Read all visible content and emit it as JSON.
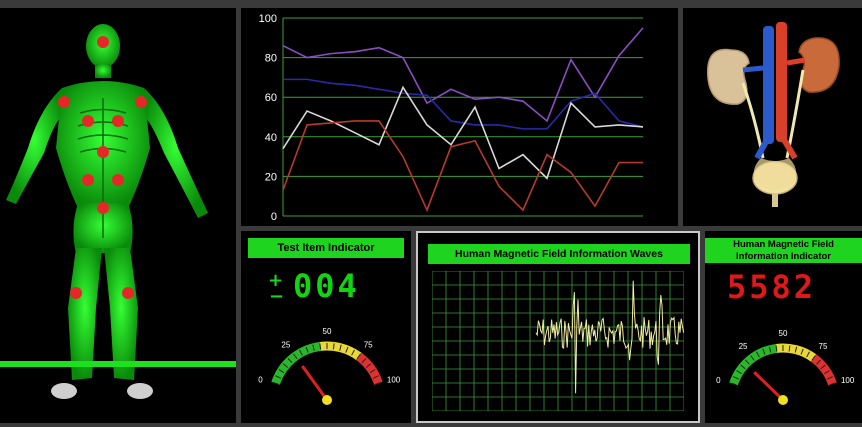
{
  "colors": {
    "green": "#1fd41f",
    "red": "#e02020",
    "lcd_green": "#12d412",
    "lcd_red": "#e01818"
  },
  "chart_data": {
    "type": "line",
    "ylim": [
      0,
      100
    ],
    "yticks": [
      0,
      20,
      40,
      60,
      80,
      100
    ],
    "x": [
      0,
      1,
      2,
      3,
      4,
      5,
      6,
      7,
      8,
      9,
      10,
      11,
      12,
      13,
      14,
      15
    ],
    "series": [
      {
        "color": "#8a4ec4",
        "values": [
          86,
          80,
          82,
          83,
          85,
          80,
          57,
          64,
          59,
          60,
          58,
          48,
          79,
          60,
          81,
          95
        ]
      },
      {
        "color": "#2a2aa8",
        "values": [
          69,
          69,
          67,
          66,
          64,
          62,
          61,
          48,
          46,
          46,
          44,
          44,
          58,
          62,
          48,
          45
        ]
      },
      {
        "color": "#d8d8d8",
        "values": [
          34,
          53,
          48,
          42,
          36,
          65,
          46,
          36,
          55,
          24,
          31,
          19,
          57,
          45,
          46,
          45
        ]
      },
      {
        "color": "#b83a2a",
        "values": [
          13,
          46,
          47,
          48,
          48,
          30,
          3,
          35,
          38,
          15,
          3,
          31,
          22,
          5,
          27,
          27
        ]
      }
    ]
  },
  "test_panel": {
    "title": "Test Item Indicator",
    "plus": "+",
    "minus": "−",
    "display": "004",
    "gauge": {
      "labels": [
        "0",
        "25",
        "50",
        "75",
        "100"
      ],
      "value": 25
    }
  },
  "wave_panel": {
    "title": "Human Magnetic Field Information Waves"
  },
  "mag_panel": {
    "title_line1": "Human Magnetic Field",
    "title_line2": "Information Indicator",
    "display": "5582",
    "gauge": {
      "labels": [
        "0",
        "25",
        "50",
        "75",
        "100"
      ],
      "value": 18
    }
  },
  "body_points": 12
}
